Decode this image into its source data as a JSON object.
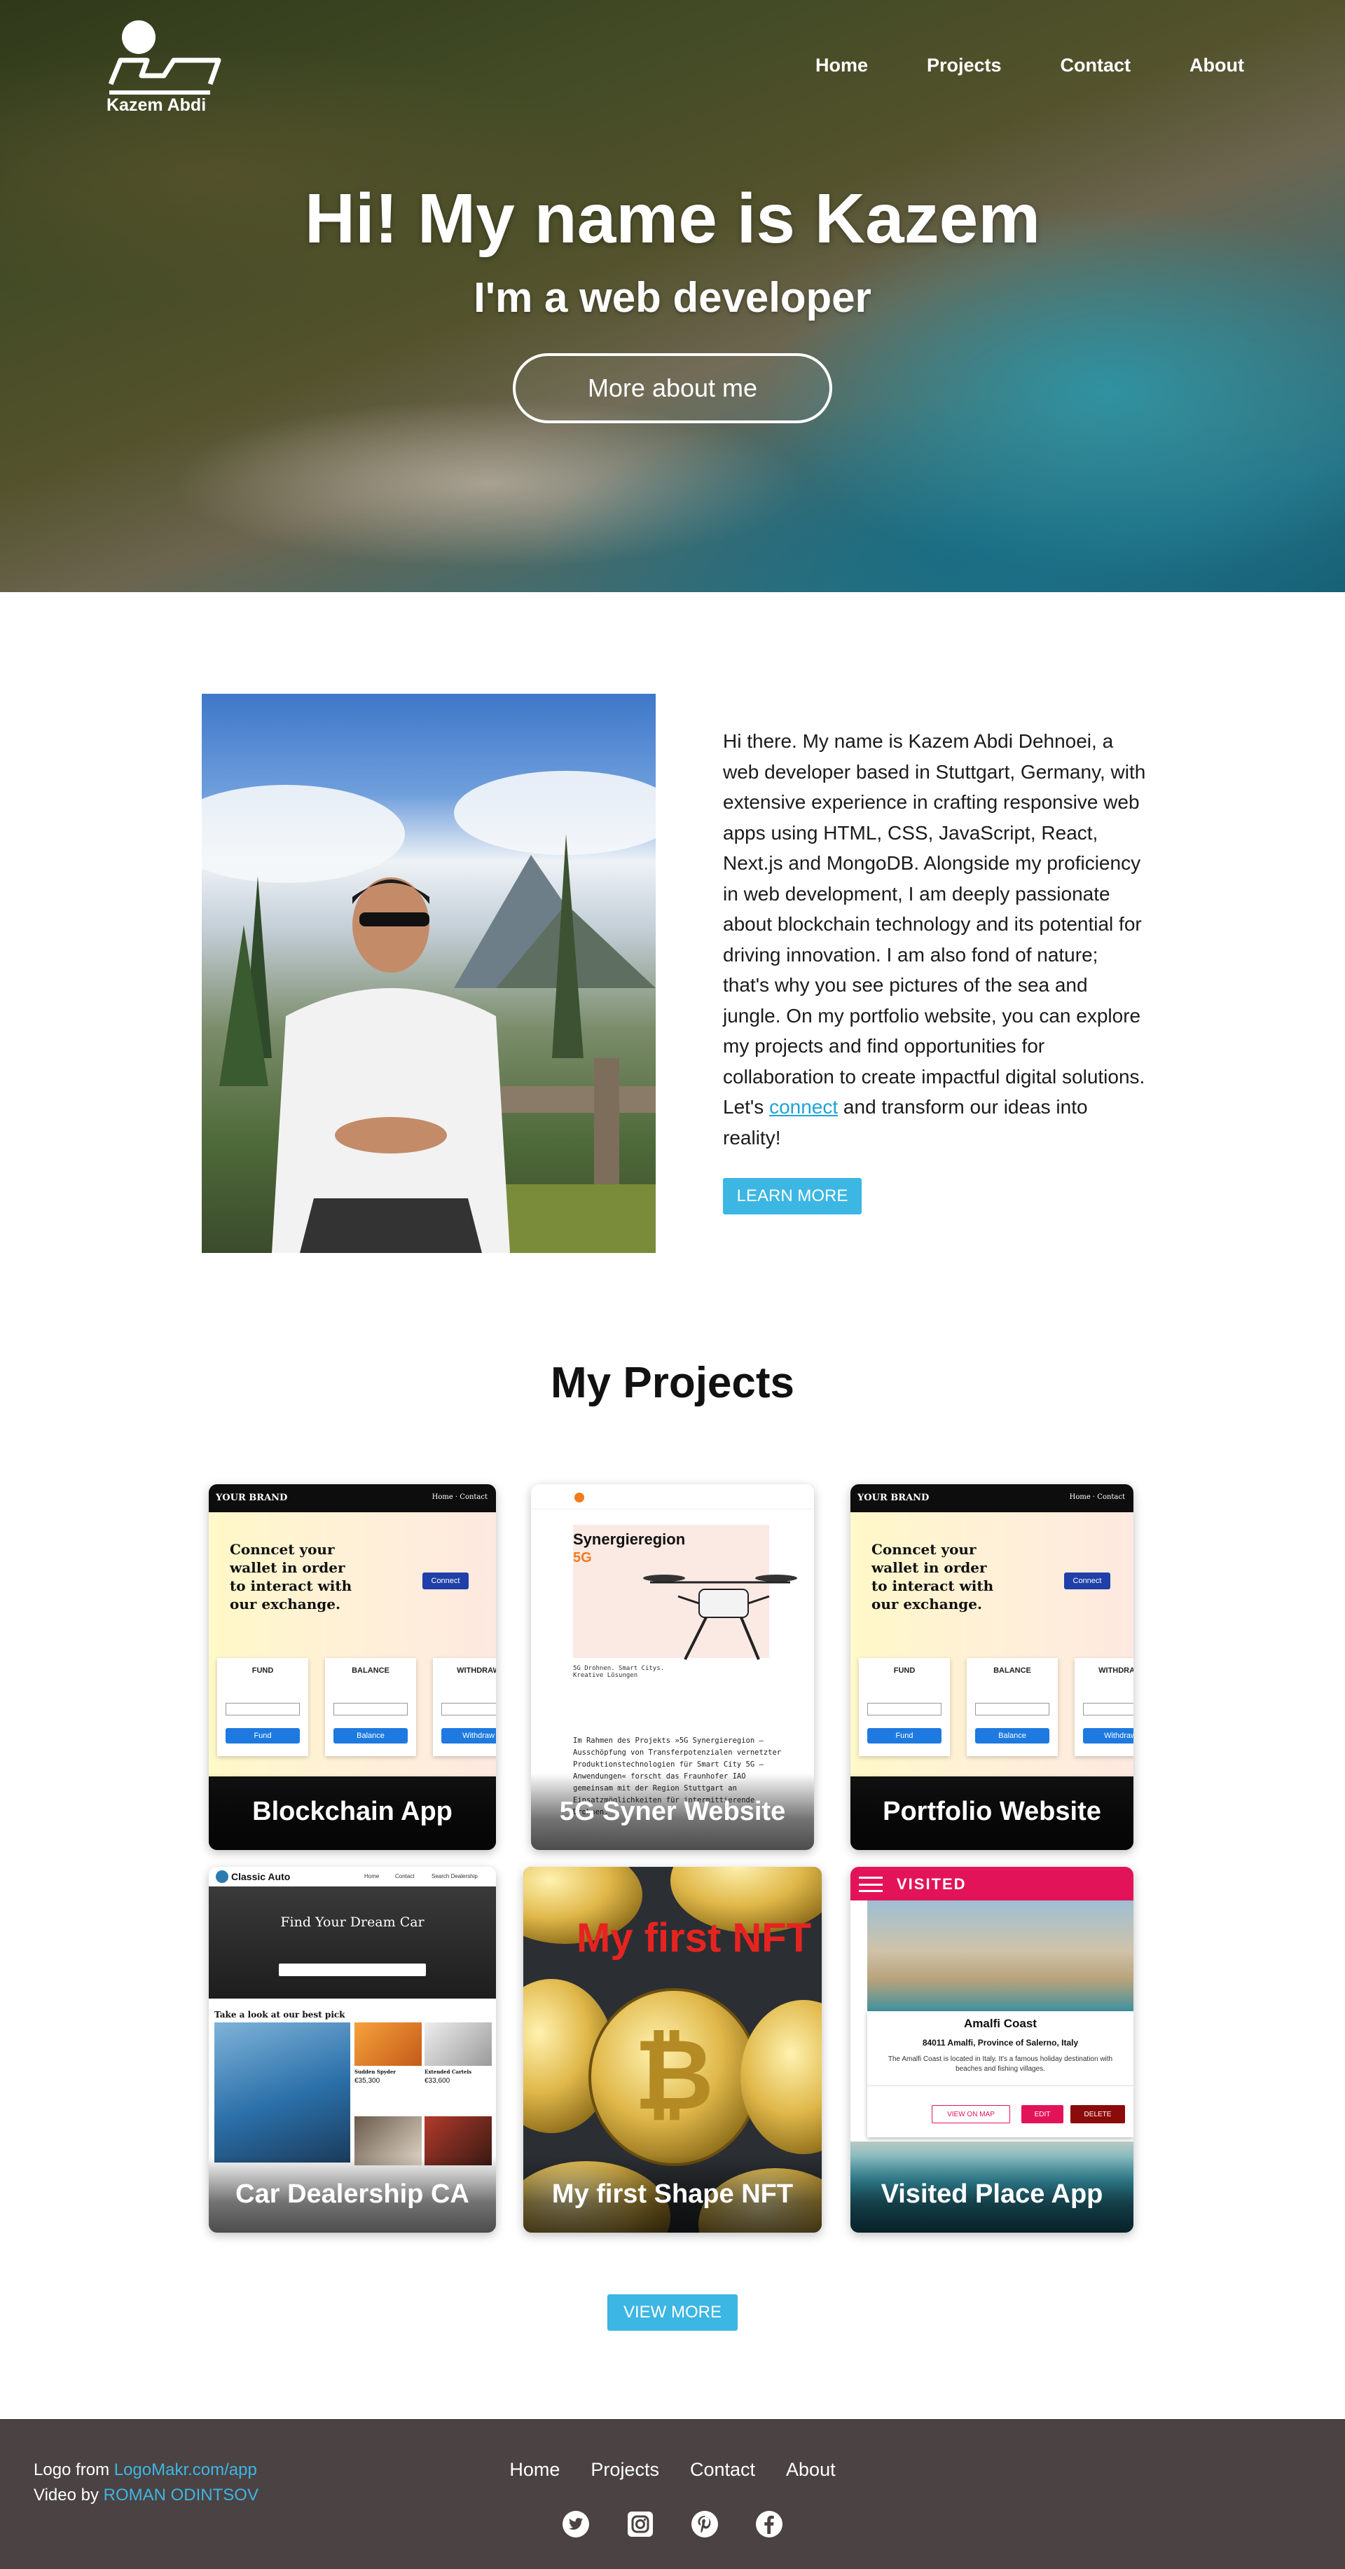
{
  "header": {
    "logo_text": "Kazem Abdi",
    "nav": [
      "Home",
      "Projects",
      "Contact",
      "About"
    ]
  },
  "hero": {
    "title": "Hi! My name is Kazem",
    "subtitle": "I'm a web developer",
    "button": "More about me"
  },
  "about": {
    "text_before": "Hi there. My name is Kazem Abdi Dehnoei, a web developer based in Stuttgart, Germany, with extensive experience in crafting responsive web apps using HTML, CSS, JavaScript, React, Next.js and MongoDB. Alongside my proficiency in web development, I am deeply passionate about blockchain technology and its potential for driving innovation. I am also fond of nature; that's why you see pictures of the sea and jungle. On my portfolio website, you can explore my projects and find opportunities for collaboration to create impactful digital solutions. Let's ",
    "link": "connect",
    "text_after": " and transform our ideas into reality!",
    "button": "LEARN MORE"
  },
  "projects": {
    "title": "My Projects",
    "items": [
      {
        "label": "Blockchain App"
      },
      {
        "label": "5G Syner Website"
      },
      {
        "label": "Portfolio Website"
      },
      {
        "label": "Car Dealership CA"
      },
      {
        "label": "My first Shape NFT"
      },
      {
        "label": "Visited Place App"
      }
    ],
    "view_more": "VIEW MORE"
  },
  "thumbs": {
    "brand": "YOUR BRAND",
    "brand_nav": "Home · Contact",
    "wallet_headline": "Conncet your wallet in order to interact with our exchange.",
    "wallet_connect": "Connect",
    "wallet_cards": [
      {
        "title": "FUND",
        "button": "Fund"
      },
      {
        "title": "BALANCE",
        "button": "Balance"
      },
      {
        "title": "WITHDRAW",
        "button": "Withdraw"
      }
    ],
    "syner_title": "Synergieregion",
    "syner_accent": "5G",
    "syner_caption": "5G Drohnen. Smart Citys. Kreative Lösungen",
    "syner_body": "Im Rahmen des Projekts »5G Synergieregion – Ausschöpfung von Transferpotenzialen vernetzter Produktionstechnologien für Smart City 5G – Anwendungen« forscht das Fraunhofer IAO gemeinsam mit der Region Stuttgart an Einsatzmöglichkeiten für intermittierende Drohnen.",
    "car_brand": "Classic Auto",
    "car_nav": [
      "Home",
      "Contact",
      "Search Dealership"
    ],
    "car_hero": "Find Your Dream Car",
    "car_section": "Take a look at our best pick",
    "car_listings": [
      {
        "name": "Sudden Spyder",
        "price": "€35,300"
      },
      {
        "name": "Extended Cartels",
        "price": "€33,600"
      }
    ],
    "nft_text": "My first NFT",
    "visited_brand": "VISITED",
    "visited_place": "Amalfi Coast",
    "visited_address": "84011 Amalfi, Province of Salerno, Italy",
    "visited_desc": "The Amalfi Coast is located in Italy. It's a famous holiday destination with beaches and fishing villages.",
    "visited_buttons": [
      "VIEW ON MAP",
      "EDIT",
      "DELETE"
    ]
  },
  "footer": {
    "logo_prefix": "Logo from ",
    "logo_link": "LogoMakr.com/app",
    "video_prefix": "Video by ",
    "video_link": "ROMAN ODINTSOV",
    "nav": [
      "Home",
      "Projects",
      "Contact",
      "About"
    ],
    "social": [
      "twitter-icon",
      "instagram-icon",
      "pinterest-icon",
      "facebook-icon"
    ]
  },
  "colors": {
    "accent": "#3cb6e3",
    "footer_bg": "#4b4243",
    "visited_pink": "#e3135a",
    "delete_red": "#8b0a0a"
  }
}
